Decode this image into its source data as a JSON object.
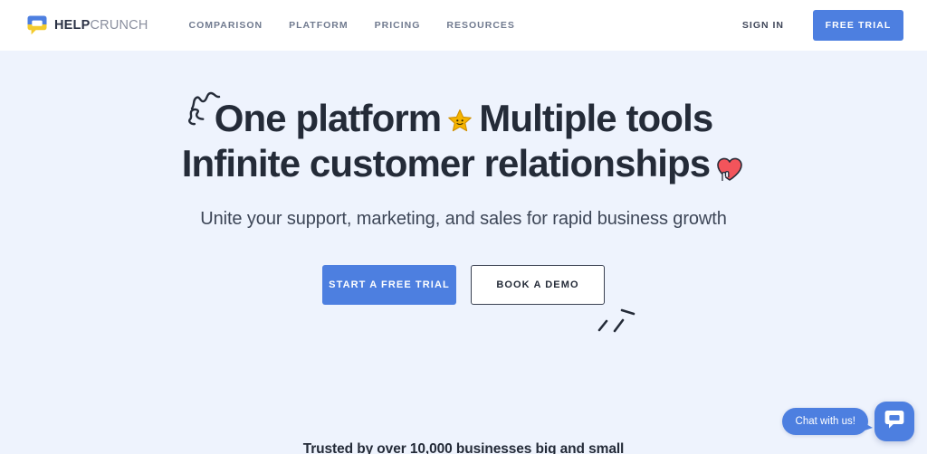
{
  "header": {
    "logo": {
      "icon": "helpcrunch-chat-logo-icon",
      "text_bold": "HELP",
      "text_light": "CRUNCH"
    },
    "nav_items": [
      {
        "label": "COMPARISON"
      },
      {
        "label": "PLATFORM"
      },
      {
        "label": "PRICING"
      },
      {
        "label": "RESOURCES"
      }
    ],
    "sign_in_label": "SIGN IN",
    "free_trial_label": "FREE TRIAL"
  },
  "hero": {
    "headline_line1_a": "One platform",
    "headline_star_emoji": "star-emoji",
    "headline_line1_b": "Multiple tools",
    "headline_line2": "Infinite customer relationships",
    "headline_heart_emoji": "heart-emoji",
    "squiggle_decoration": "squiggle-decoration-icon",
    "burst_decoration": "burst-decoration-icon",
    "subtitle": "Unite your support, marketing, and sales for rapid business growth",
    "primary_cta_label": "START A FREE TRIAL",
    "secondary_cta_label": "BOOK A DEMO",
    "trusted_text": "Trusted by over 10,000 businesses big and small"
  },
  "chat_widget": {
    "bubble_text": "Chat with us!",
    "launcher_icon": "chat-bubble-icon"
  },
  "colors": {
    "accent_blue": "#4d7fe0",
    "page_background": "#eef3fd",
    "header_background": "#ffffff",
    "heading_text": "#242b38",
    "nav_text": "#707a8f",
    "logo_yellow": "#f3cb2e"
  }
}
